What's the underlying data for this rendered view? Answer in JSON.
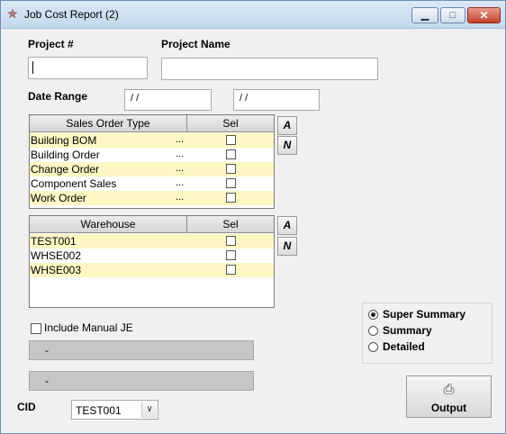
{
  "window": {
    "title": "Job Cost Report (2)",
    "minimize": "▁",
    "maximize": "□",
    "close": "✕"
  },
  "project": {
    "number_label": "Project #",
    "name_label": "Project Name",
    "number_value": "",
    "name_value": ""
  },
  "date_range": {
    "label": "Date Range",
    "from": "/ /",
    "to": "/ /"
  },
  "sales_order_grid": {
    "col_type": "Sales Order Type",
    "col_sel": "Sel",
    "rows": [
      {
        "name": "Building BOM",
        "dots": "...",
        "checked": false
      },
      {
        "name": "Building Order",
        "dots": "...",
        "checked": false
      },
      {
        "name": "Change Order",
        "dots": "...",
        "checked": false
      },
      {
        "name": "Component Sales",
        "dots": "...",
        "checked": false
      },
      {
        "name": "Work Order",
        "dots": "...",
        "checked": false
      }
    ]
  },
  "warehouse_grid": {
    "col_type": "Warehouse",
    "col_sel": "Sel",
    "rows": [
      {
        "name": "TEST001",
        "checked": false
      },
      {
        "name": "WHSE002",
        "checked": false
      },
      {
        "name": "WHSE003",
        "checked": false
      }
    ]
  },
  "side_buttons": {
    "all": "A",
    "none": "N"
  },
  "include_manual_je": {
    "label": "Include Manual JE",
    "checked": false
  },
  "bars": {
    "first": "-",
    "second": "-"
  },
  "summary_options": {
    "options": [
      "Super Summary",
      "Summary",
      "Detailed"
    ],
    "selected": "Super Summary"
  },
  "output_button": {
    "label": "Output",
    "icon": "printer-icon"
  },
  "cid": {
    "label": "CID",
    "value": "TEST001"
  }
}
